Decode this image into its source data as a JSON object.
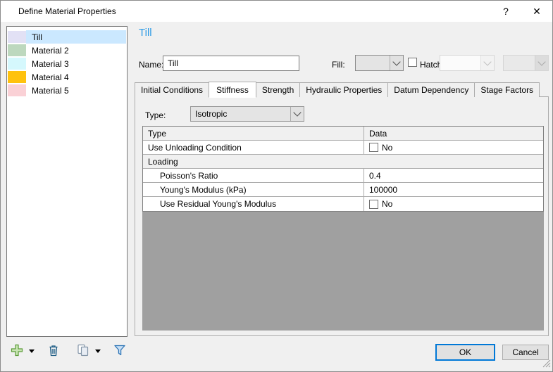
{
  "dialog": {
    "title": "Define Material Properties",
    "help_label": "?",
    "close_label": "✕"
  },
  "material_list": {
    "selected_highlight": "#CBE8FF",
    "items": [
      {
        "name": "Till",
        "color": "#E2E1F5",
        "selected": true
      },
      {
        "name": "Material 2",
        "color": "#BDD8BE",
        "selected": false
      },
      {
        "name": "Material 3",
        "color": "#D5F8FD",
        "selected": false
      },
      {
        "name": "Material 4",
        "color": "#FFC20E",
        "selected": false
      },
      {
        "name": "Material 5",
        "color": "#FAD1D6",
        "selected": false
      }
    ]
  },
  "detail": {
    "heading": "Till"
  },
  "form": {
    "name_label": "Name:",
    "name_value": "Till",
    "fill_label": "Fill:",
    "fill_color": "#E2E1F5",
    "hatch_label": "Hatch:",
    "hatch_checked": false
  },
  "tabs": {
    "items": [
      "Initial Conditions",
      "Stiffness",
      "Strength",
      "Hydraulic Properties",
      "Datum Dependency",
      "Stage Factors"
    ],
    "active": "Stiffness"
  },
  "stiffness_tab": {
    "type_label": "Type:",
    "type_value": "Isotropic",
    "table": {
      "col_headers": [
        "Type",
        "Data"
      ],
      "rows": [
        {
          "kind": "checkbox",
          "label": "Use Unloading Condition",
          "value": "No",
          "checked": false,
          "indent": false
        },
        {
          "kind": "category",
          "label": "Loading"
        },
        {
          "kind": "value",
          "label": "Poisson's Ratio",
          "value": "0.4",
          "indent": true
        },
        {
          "kind": "value",
          "label": "Young's Modulus (kPa)",
          "value": "100000",
          "indent": true
        },
        {
          "kind": "checkbox",
          "label": "Use Residual Young's Modulus",
          "value": "No",
          "checked": false,
          "indent": true
        }
      ]
    }
  },
  "toolbar": {
    "icons": [
      {
        "name": "add-material-icon",
        "glyph": "green-plus",
        "has_dropdown": true
      },
      {
        "name": "delete-material-icon",
        "glyph": "trash-can",
        "has_dropdown": false
      },
      {
        "name": "copy-material-icon",
        "glyph": "copy-pages",
        "has_dropdown": true
      },
      {
        "name": "filter-materials-icon",
        "glyph": "filter-funnel",
        "has_dropdown": false
      }
    ]
  },
  "footer": {
    "ok_label": "OK",
    "cancel_label": "Cancel"
  },
  "colors": {
    "accent_heading_blue": "#2D9BE6",
    "selection_blue": "#CBE8FF",
    "table_filler_gray": "#A0A0A0",
    "ok_focus_border": "#0078D7",
    "button_face": "#E1E1E1"
  }
}
